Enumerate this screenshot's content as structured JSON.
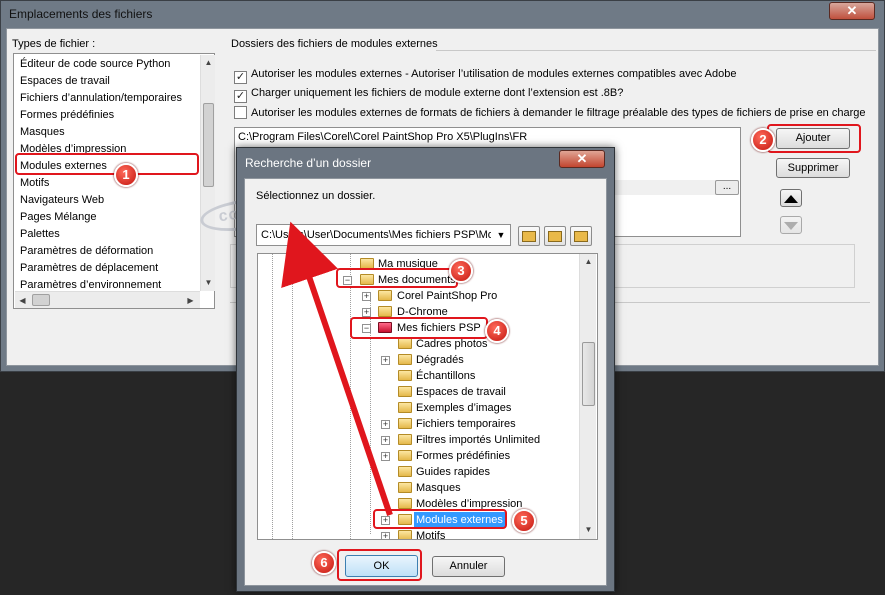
{
  "main_window": {
    "title": "Emplacements des fichiers",
    "close": "✕"
  },
  "types": {
    "label": "Types de fichier :",
    "items": [
      "Éditeur de code source Python",
      "Espaces de travail",
      "Fichiers d’annulation/temporaires",
      "Formes prédéfinies",
      "Masques",
      "Modèles d’impression",
      "Modules externes",
      "Motifs",
      "Navigateurs Web",
      "Pages Mélange",
      "Palettes",
      "Paramètres de déformation",
      "Paramètres de déplacement",
      "Paramètres d’environnement"
    ],
    "selected_index": 6
  },
  "plugins": {
    "group_label": "Dossiers des fichiers de modules externes",
    "options": [
      {
        "label": "Autoriser les modules externes - Autoriser l’utilisation de modules externes compatibles avec Adobe",
        "checked": true
      },
      {
        "label": "Charger uniquement les fichiers de module externe dont l’extension est .8B?",
        "checked": true
      },
      {
        "label": "Autoriser les modules externes de formats de fichiers à demander le filtrage préalable des types de fichiers de prise en charge",
        "checked": false
      }
    ],
    "path": "C:\\Program Files\\Corel\\Corel PaintShop Pro X5\\PlugIns\\FR",
    "browse": "...",
    "add": "Ajouter",
    "remove": "Supprimer"
  },
  "dialog": {
    "title": "Recherche d’un dossier",
    "close": "✕",
    "prompt": "Sélectionnez un dossier.",
    "path": "C:\\Users\\User\\Documents\\Mes fichiers PSP\\Mod",
    "tree": [
      "Ma musique",
      "Mes documents",
      "Corel PaintShop Pro",
      "D-Chrome",
      "Mes fichiers PSP",
      "Cadres photos",
      "Dégradés",
      "Échantillons",
      "Espaces de travail",
      "Exemples d’images",
      "Fichiers temporaires",
      "Filtres  importés Unlimited",
      "Formes prédéfinies",
      "Guides rapides",
      "Masques",
      "Modèles d’impression",
      "Modules externes",
      "Motifs"
    ],
    "ok": "OK",
    "cancel": "Annuler"
  },
  "annotations": [
    "1",
    "2",
    "3",
    "4",
    "5",
    "6"
  ],
  "watermark": "coeur",
  "colors": {
    "highlight": "#e0161d",
    "selection": "#3399ff"
  }
}
